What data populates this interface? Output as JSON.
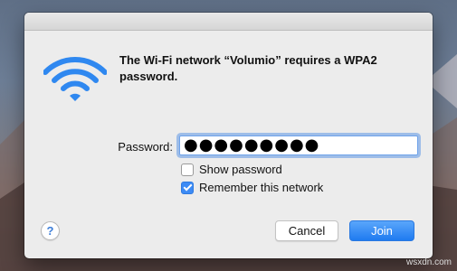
{
  "dialog": {
    "message": "The Wi-Fi network “Volumio” requires a WPA2 password.",
    "password_label": "Password:",
    "password_value": "●●●●●●●●●",
    "show_password_label": "Show password",
    "show_password_checked": false,
    "remember_label": "Remember this network",
    "remember_checked": true,
    "help_label": "?",
    "cancel_label": "Cancel",
    "join_label": "Join"
  },
  "watermark": "wsxdn.com",
  "icons": {
    "wifi": "wifi-icon",
    "help": "help-icon"
  },
  "colors": {
    "accent": "#1f7bf0",
    "wifi_blue": "#2f88f0"
  }
}
